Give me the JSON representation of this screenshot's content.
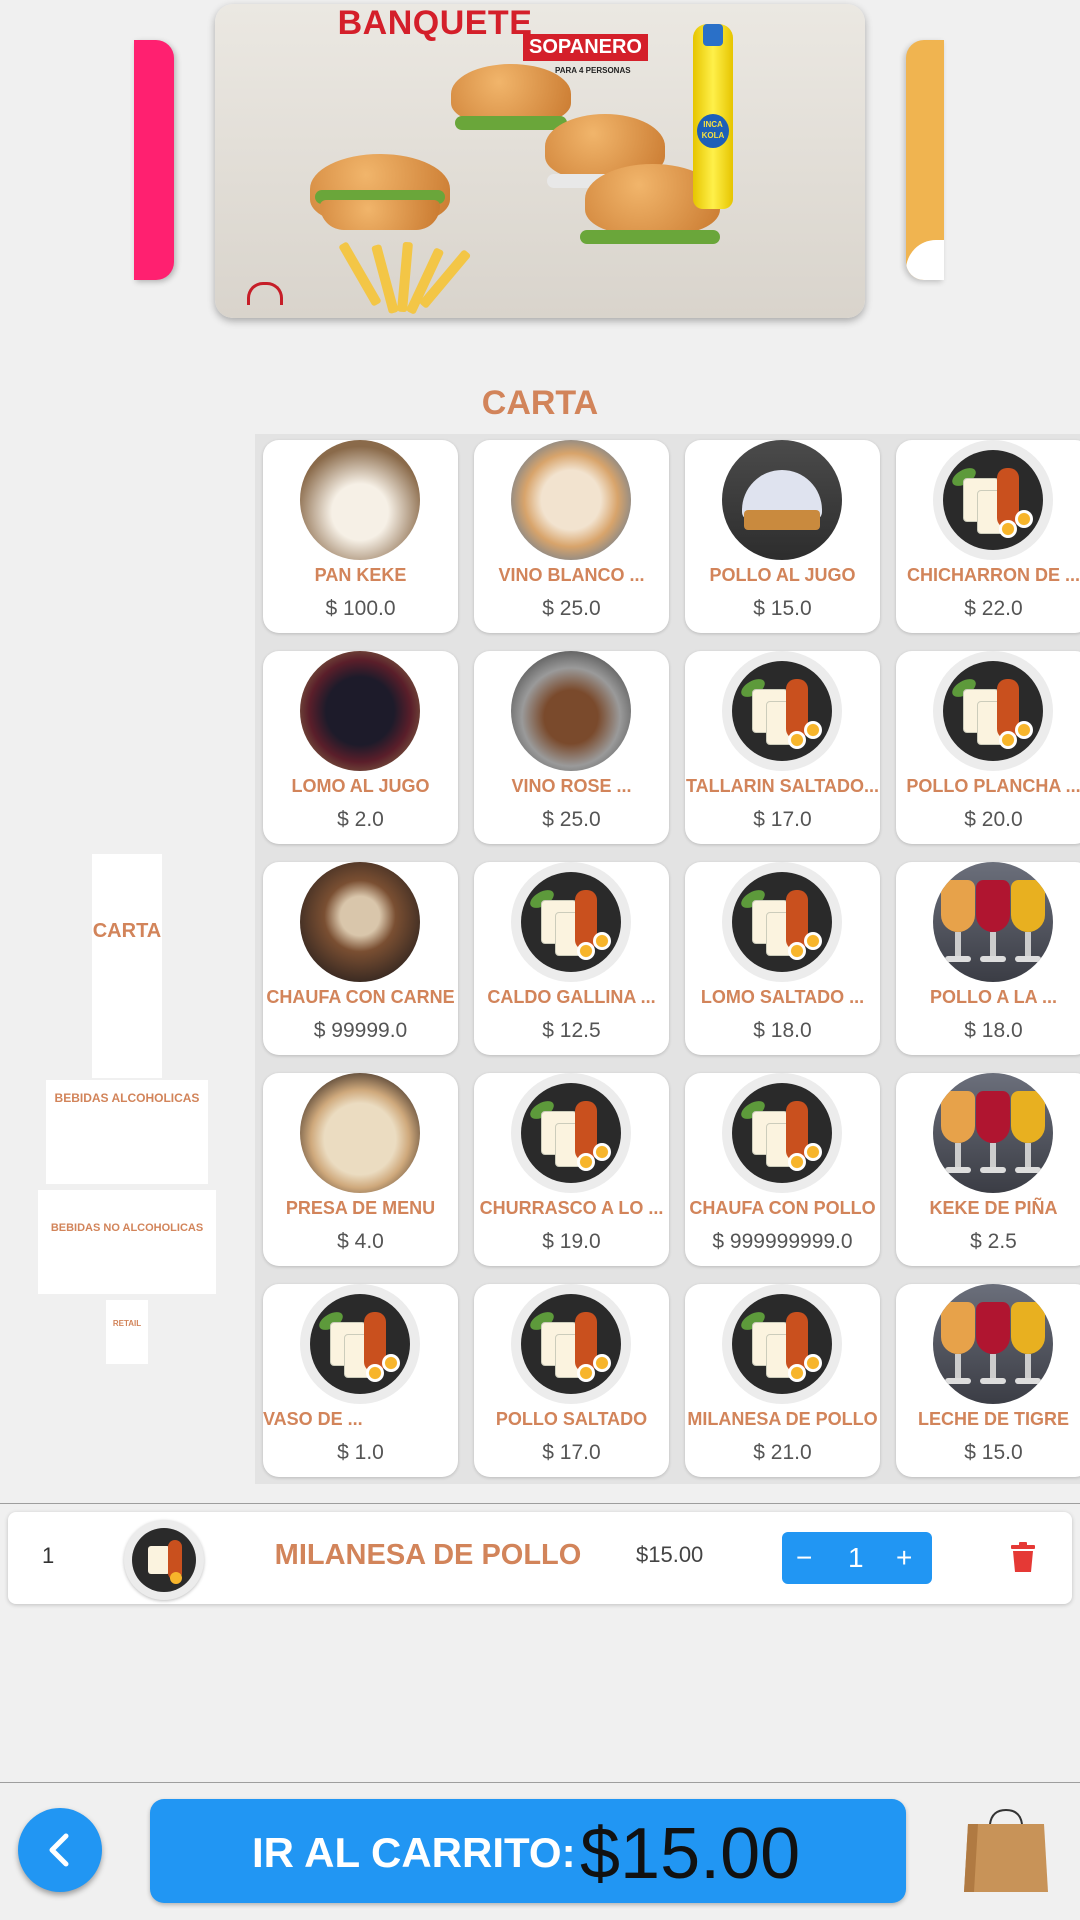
{
  "banner": {
    "title": "BANQUETE",
    "subtitle": "SOPANERO",
    "caption": "PARA 4 PERSONAS",
    "bottle_label": "INCA KOLA"
  },
  "section_title": "CARTA",
  "sidebar": {
    "items": [
      {
        "label": "CARTA"
      },
      {
        "label": "BEBIDAS ALCOHOLICAS"
      },
      {
        "label": "BEBIDAS NO ALCOHOLICAS"
      },
      {
        "label": "RETAIL"
      }
    ]
  },
  "products": [
    {
      "name": "PAN KEKE",
      "price": "$ 100.0",
      "image": "plate-photo"
    },
    {
      "name": "VINO BLANCO ...",
      "price": "$ 25.0",
      "image": "tart-photo"
    },
    {
      "name": "POLLO AL JUGO",
      "price": "$ 15.0",
      "image": "pie-photo"
    },
    {
      "name": "CHICHARRON DE ...",
      "price": "$ 22.0",
      "image": "bread-plate"
    },
    {
      "name": "LOMO AL JUGO",
      "price": "$ 2.0",
      "image": "berry-photo"
    },
    {
      "name": "VINO ROSE ...",
      "price": "$ 25.0",
      "image": "chocolate-photo"
    },
    {
      "name": "TALLARIN SALTADO...",
      "price": "$ 17.0",
      "image": "bread-plate"
    },
    {
      "name": "POLLO PLANCHA ...",
      "price": "$ 20.0",
      "image": "bread-plate"
    },
    {
      "name": "CHAUFA CON CARNE",
      "price": "$ 99999.0",
      "image": "cup-photo"
    },
    {
      "name": "CALDO GALLINA ...",
      "price": "$ 12.5",
      "image": "bread-plate"
    },
    {
      "name": "LOMO SALTADO ...",
      "price": "$ 18.0",
      "image": "bread-plate"
    },
    {
      "name": "POLLO A LA ...",
      "price": "$ 18.0",
      "image": "drinks-photo"
    },
    {
      "name": "PRESA DE MENU",
      "price": "$ 4.0",
      "image": "rice-photo"
    },
    {
      "name": "CHURRASCO A LO ...",
      "price": "$ 19.0",
      "image": "bread-plate"
    },
    {
      "name": "CHAUFA CON POLLO",
      "price": "$ 999999999.0",
      "image": "bread-plate"
    },
    {
      "name": "KEKE DE PIÑA",
      "price": "$ 2.5",
      "image": "drinks-photo"
    },
    {
      "name": "VASO DE ...",
      "price": "$ 1.0",
      "image": "bread-plate"
    },
    {
      "name": "POLLO SALTADO",
      "price": "$ 17.0",
      "image": "bread-plate"
    },
    {
      "name": "MILANESA DE POLLO",
      "price": "$ 21.0",
      "image": "bread-plate"
    },
    {
      "name": "LECHE DE TIGRE",
      "price": "$ 15.0",
      "image": "drinks-photo"
    }
  ],
  "cart_line": {
    "index": "1",
    "name": "MILANESA DE POLLO",
    "price": "$15.00",
    "quantity": "1",
    "minus": "−",
    "plus": "+"
  },
  "footer": {
    "cart_label": "IR AL CARRITO:",
    "cart_total": "$15.00"
  },
  "colors": {
    "accent": "#2196f3",
    "product_text": "#d2845a",
    "delete": "#e53935"
  }
}
